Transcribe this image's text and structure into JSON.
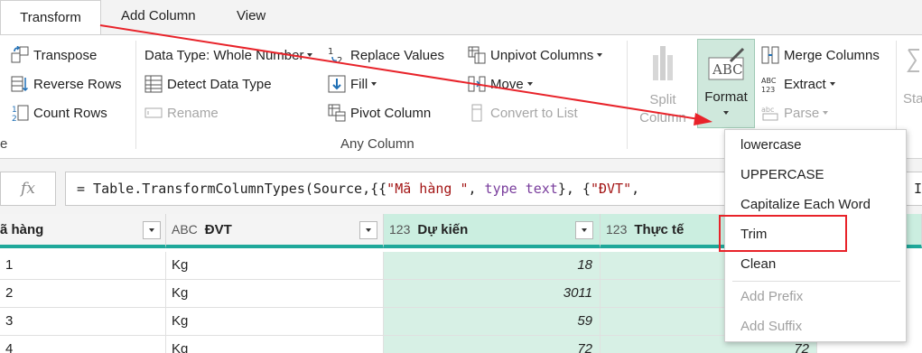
{
  "tabs": [
    "Transform",
    "Add Column",
    "View"
  ],
  "ribbon": {
    "table_group": {
      "transpose": "Transpose",
      "reverse_rows": "Reverse Rows",
      "count_rows": "Count Rows",
      "group_label_fragment": "e"
    },
    "any_column": {
      "data_type": "Data Type: Whole Number",
      "detect_data_type": "Detect Data Type",
      "rename": "Rename",
      "replace_values": "Replace Values",
      "fill": "Fill",
      "pivot_column": "Pivot Column",
      "unpivot_columns": "Unpivot Columns",
      "move": "Move",
      "convert_to_list": "Convert to List",
      "group_label": "Any Column"
    },
    "text_column": {
      "split_column_line1": "Split",
      "split_column_line2": "Column",
      "format": "Format",
      "format_icon_text": "ABC",
      "merge_columns": "Merge Columns",
      "extract": "Extract",
      "parse": "Parse",
      "next_fragment": "Sta"
    }
  },
  "formula_bar": {
    "fx": "fx",
    "prefix": "= Table.TransformColumnTypes(Source,{{",
    "s1": "\"Mã hàng \"",
    "sep1": ", ",
    "kw1": "type text",
    "mid": "}, {",
    "s2": "\"ĐVT\"",
    "tail": ",",
    "right_fragment": "I"
  },
  "grid": {
    "columns": [
      {
        "name": "ã hàng",
        "type": ""
      },
      {
        "name": "ĐVT",
        "type": "ABC"
      },
      {
        "name": "Dự kiến",
        "type": "123"
      },
      {
        "name": "Thực tế",
        "type": "123"
      }
    ],
    "rows": [
      {
        "id": "1",
        "dvt": "Kg",
        "du_kien": "18",
        "thuc_te": ""
      },
      {
        "id": "2",
        "dvt": "Kg",
        "du_kien": "3011",
        "thuc_te": ""
      },
      {
        "id": "3",
        "dvt": "Kg",
        "du_kien": "59",
        "thuc_te": ""
      },
      {
        "id": "4",
        "dvt": "Kg",
        "du_kien": "72",
        "thuc_te": "72"
      }
    ]
  },
  "format_menu": {
    "items": [
      "lowercase",
      "UPPERCASE",
      "Capitalize Each Word",
      "Trim",
      "Clean"
    ],
    "disabled_items": [
      "Add Prefix",
      "Add Suffix"
    ],
    "highlighted": "Trim"
  },
  "colors": {
    "annotation_red": "#e8232a",
    "selected_column": "#cbeee0",
    "header_underline": "#1fa89a"
  }
}
